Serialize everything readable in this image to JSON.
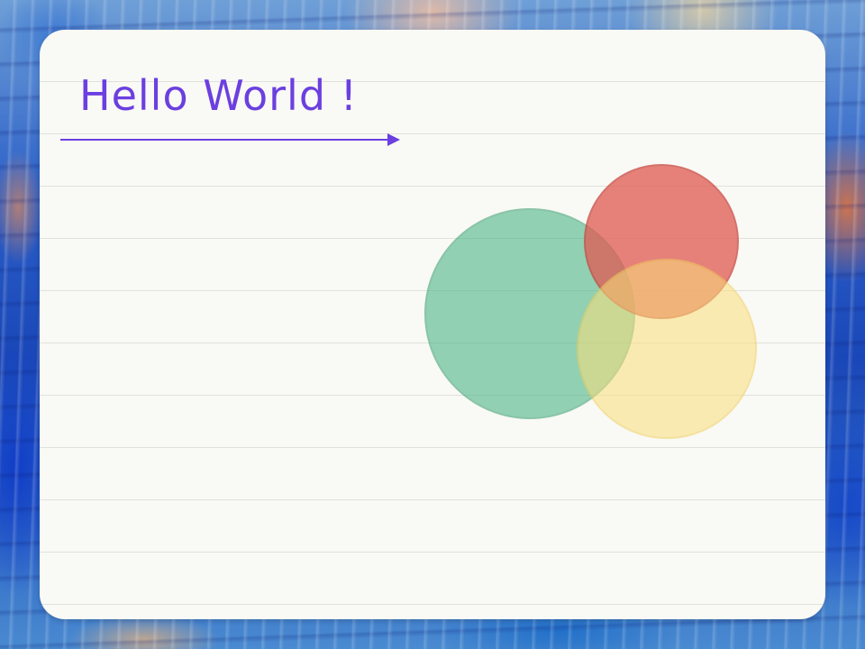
{
  "note": {
    "title": "Hello World !",
    "title_color": "#6b3fe0",
    "underline_arrow_color": "#6b3fe0"
  },
  "shapes": {
    "circles": [
      {
        "name": "green",
        "fill": "#3db07e",
        "stroke": "#2e9966"
      },
      {
        "name": "red",
        "fill": "#e05a52",
        "stroke": "#c8443d"
      },
      {
        "name": "yellow",
        "fill": "#f9df7a",
        "stroke": "#f0cf5a"
      }
    ]
  }
}
